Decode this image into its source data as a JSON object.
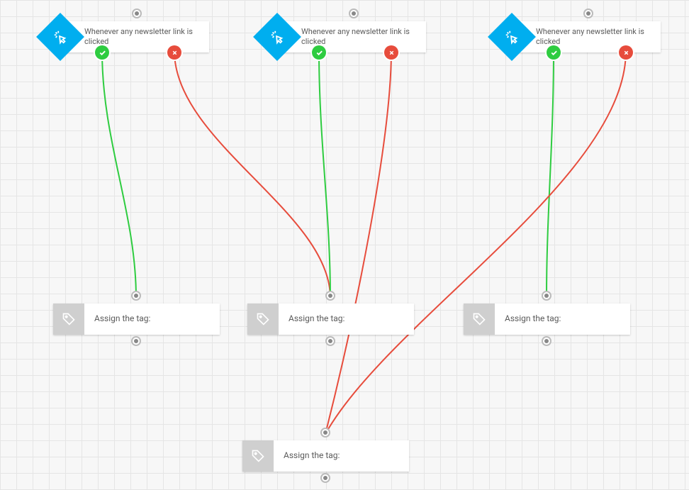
{
  "colors": {
    "trigger_icon_bg": "#00aeef",
    "action_icon_bg": "#cfcfcf",
    "success": "#2ecc40",
    "error": "#e74c3c",
    "connector_green": "#2ecc40",
    "connector_red": "#e74c3c"
  },
  "nodes": {
    "trigger1": {
      "label": "Whenever any newsletter link is clicked"
    },
    "trigger2": {
      "label": "Whenever any newsletter link is clicked"
    },
    "trigger3": {
      "label": "Whenever any newsletter link is clicked"
    },
    "action1": {
      "label": "Assign the tag:"
    },
    "action2": {
      "label": "Assign the tag:"
    },
    "action3": {
      "label": "Assign the tag:"
    },
    "action4": {
      "label": "Assign the tag:"
    }
  },
  "icons": {
    "trigger": "cursor-click-icon",
    "action": "tag-icon",
    "success": "check-icon",
    "error": "x-icon"
  },
  "connections": [
    {
      "from": "trigger1",
      "port": "success",
      "to": "action1"
    },
    {
      "from": "trigger1",
      "port": "error",
      "to": "action2"
    },
    {
      "from": "trigger2",
      "port": "success",
      "to": "action2"
    },
    {
      "from": "trigger2",
      "port": "error",
      "to": "action4"
    },
    {
      "from": "trigger3",
      "port": "success",
      "to": "action3"
    },
    {
      "from": "trigger3",
      "port": "error",
      "to": "action4"
    }
  ]
}
